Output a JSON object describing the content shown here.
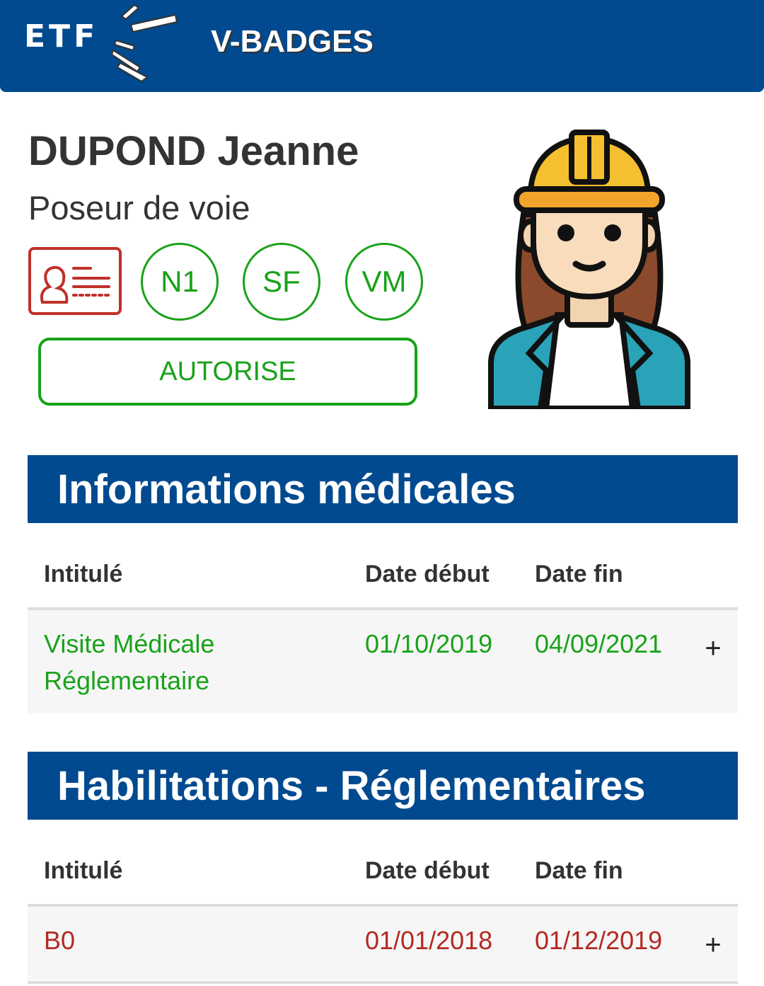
{
  "header": {
    "logo_text": "ETF",
    "app_title": "V-BADGES",
    "colors": {
      "bar": "#014a8f",
      "text": "#ffffff"
    }
  },
  "profile": {
    "name": "DUPOND Jeanne",
    "role": "Poseur de voie",
    "id_card_icon": "id-card-icon",
    "badges": [
      "N1",
      "SF",
      "VM"
    ],
    "status": "AUTORISE",
    "avatar_icon": "worker-woman-avatar-icon",
    "colors": {
      "ok": "#19a21a",
      "card": "#c0302a"
    }
  },
  "medical": {
    "title": "Informations médicales",
    "columns": [
      "Intitulé",
      "Date début",
      "Date fin"
    ],
    "rows": [
      {
        "label": "Visite Médicale Réglementaire",
        "start": "01/10/2019",
        "end": "04/09/2021",
        "expand": "+",
        "status_color": "#19a21a"
      }
    ]
  },
  "habilitations": {
    "title": "Habilitations - Réglementaires",
    "columns": [
      "Intitulé",
      "Date début",
      "Date fin"
    ],
    "rows": [
      {
        "label": "B0",
        "start": "01/01/2018",
        "end": "01/12/2019",
        "expand": "+",
        "status_color": "#b22a22"
      }
    ]
  }
}
